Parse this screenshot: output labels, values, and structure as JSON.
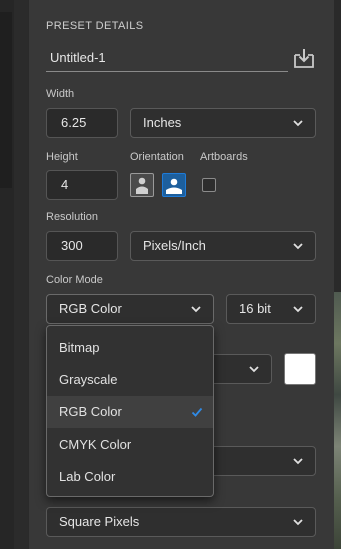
{
  "preset": {
    "section_title": "PRESET DETAILS",
    "name": "Untitled-1"
  },
  "width": {
    "label": "Width",
    "value": "6.25",
    "unit": "Inches"
  },
  "height": {
    "label": "Height",
    "value": "4"
  },
  "orientation": {
    "label": "Orientation",
    "selected": "landscape"
  },
  "artboards": {
    "label": "Artboards",
    "checked": false
  },
  "resolution": {
    "label": "Resolution",
    "value": "300",
    "unit": "Pixels/Inch"
  },
  "color_mode": {
    "label": "Color Mode",
    "selected": "RGB Color",
    "bit_depth": "16 bit",
    "options": [
      "Bitmap",
      "Grayscale",
      "RGB Color",
      "CMYK Color",
      "Lab Color"
    ]
  },
  "background": {
    "swatch_color": "#ffffff"
  },
  "pixel_aspect": {
    "value": "Square Pixels"
  },
  "colors": {
    "accent": "#1e7bd8",
    "panel": "#383838"
  },
  "icons": {
    "save_preset": "save-preset-icon",
    "dropdown": "chevron-down-icon",
    "check": "checkmark-icon"
  }
}
